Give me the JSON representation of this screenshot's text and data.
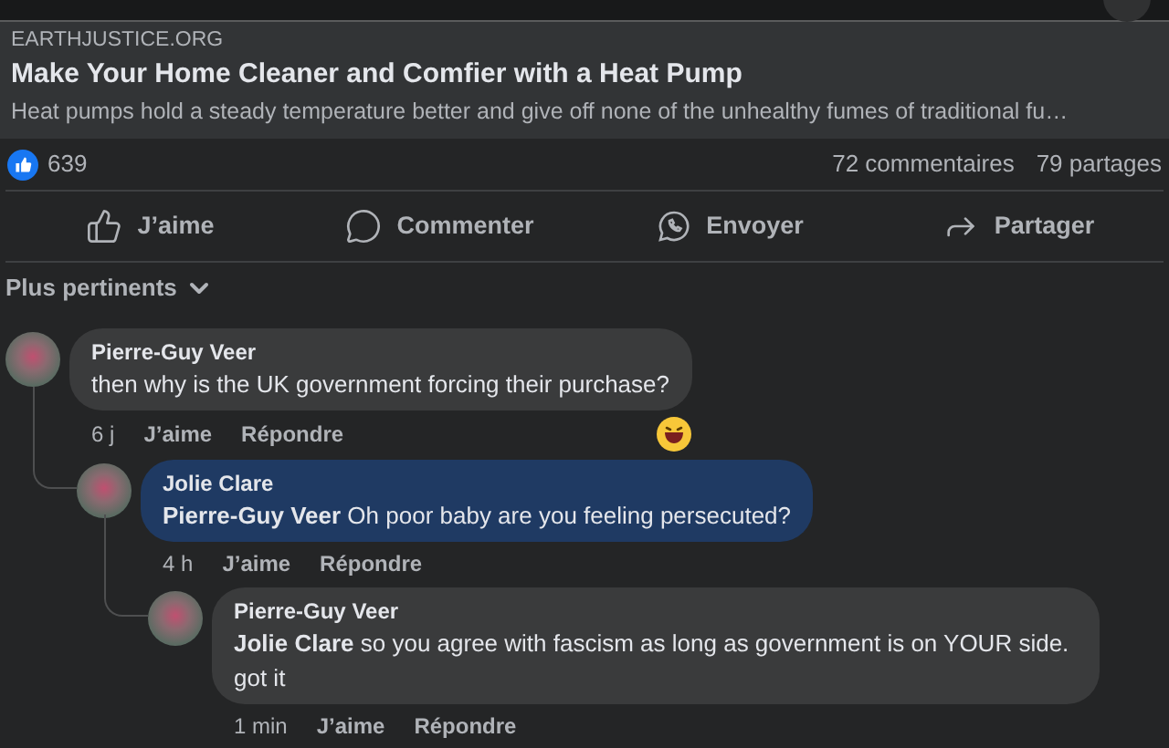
{
  "link_preview": {
    "domain": "EARTHJUSTICE.ORG",
    "title": "Make Your Home Cleaner and Comfier with a Heat Pump",
    "description": "Heat pumps hold a steady temperature better and give off none of the unhealthy fumes of traditional fu…"
  },
  "stats": {
    "likes": "639",
    "comments": "72 commentaires",
    "shares": "79 partages"
  },
  "actions": [
    {
      "kind": "like",
      "label": "J’aime"
    },
    {
      "kind": "comment",
      "label": "Commenter"
    },
    {
      "kind": "send",
      "label": "Envoyer"
    },
    {
      "kind": "share",
      "label": "Partager"
    }
  ],
  "sort": {
    "label": "Plus pertinents"
  },
  "comments": [
    {
      "author": "Pierre-Guy Veer",
      "text": "then why is the UK government forcing their purchase?",
      "highlighted": false,
      "time": "6 j",
      "like": "J’aime",
      "reply": "Répondre",
      "has_reaction": true,
      "children": [
        {
          "author": "Jolie Clare",
          "text": "**Pierre-Guy Veer** Oh poor baby are you feeling persecuted?",
          "highlighted": true,
          "time": "4 h",
          "like": "J’aime",
          "reply": "Répondre",
          "children": [
            {
              "author": "Pierre-Guy Veer",
              "text": "**Jolie Clare** so you agree with fascism as long as government is on YOUR side. got it",
              "highlighted": false,
              "time": "1 min",
              "like": "J’aime",
              "reply": "Répondre"
            }
          ]
        }
      ]
    }
  ]
}
